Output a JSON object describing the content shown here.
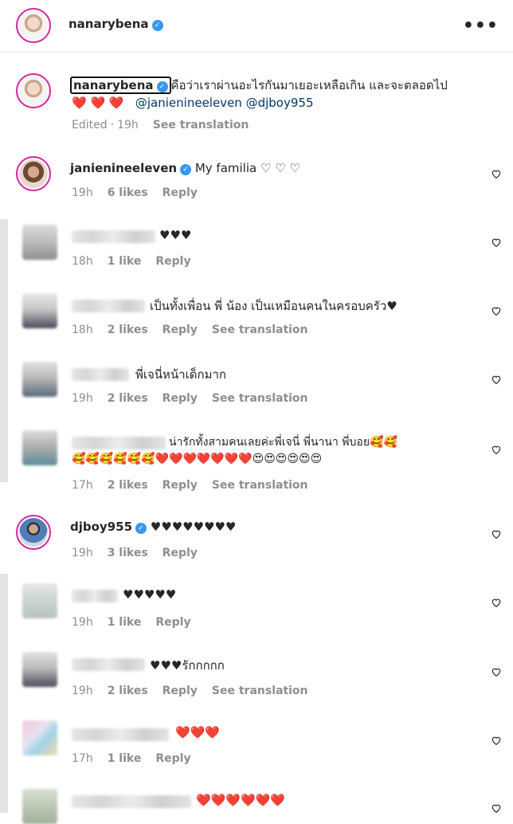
{
  "header": {
    "username": "nanarybena",
    "more_label": "•••"
  },
  "post": {
    "username": "nanarybena",
    "caption_line1": "คือว่าเราผ่านอะไรกันมาเยอะเหลือเกิน และจะตลอดไป",
    "hearts": "❤️ ❤️ ❤️",
    "mention1": "@janienineeleven",
    "mention2": "@djboy955",
    "edited": "Edited",
    "time": "19h",
    "see_translation": "See translation"
  },
  "comments": [
    {
      "username": "janienineeleven",
      "verified": true,
      "text": "My familia ♡ ♡ ♡",
      "time": "19h",
      "likes": "6 likes",
      "reply": "Reply",
      "see_translation": ""
    },
    {
      "username": "",
      "verified": false,
      "text": "♥♥♥",
      "time": "18h",
      "likes": "1 like",
      "reply": "Reply",
      "see_translation": ""
    },
    {
      "username": "",
      "verified": false,
      "text": "เป็นทั้งเพื่อน พี่ น้อง เป็นเหมือนคนในครอบครัว♥",
      "time": "18h",
      "likes": "2 likes",
      "reply": "Reply",
      "see_translation": "See translation"
    },
    {
      "username": "",
      "verified": false,
      "text": "พี่เจนี่หน้าเด็กมาก",
      "time": "19h",
      "likes": "2 likes",
      "reply": "Reply",
      "see_translation": "See translation"
    },
    {
      "username": "",
      "verified": false,
      "text": "น่ารักทั้งสามคนเลยค่ะพี่เจนี่ พี่นานา พี่บอย🥰🥰",
      "text2": "🥰🥰🥰🥰🥰🥰❤️❤️❤️❤️❤️❤️❤️😍😍😍😍😍😍",
      "time": "17h",
      "likes": "2 likes",
      "reply": "Reply",
      "see_translation": "See translation"
    },
    {
      "username": "djboy955",
      "verified": true,
      "text": "♥♥♥♥♥♥♥♥",
      "time": "19h",
      "likes": "3 likes",
      "reply": "Reply",
      "see_translation": ""
    },
    {
      "username": "",
      "verified": false,
      "text": "♥♥♥♥♥",
      "time": "19h",
      "likes": "1 like",
      "reply": "Reply",
      "see_translation": ""
    },
    {
      "username": "",
      "verified": false,
      "text": "♥♥♥รักกกกก",
      "time": "19h",
      "likes": "2 likes",
      "reply": "Reply",
      "see_translation": "See translation"
    },
    {
      "username": "",
      "verified": false,
      "text": "❤️❤️❤️",
      "time": "17h",
      "likes": "1 like",
      "reply": "Reply",
      "see_translation": ""
    },
    {
      "username": "",
      "verified": false,
      "text": "❤️❤️❤️❤️❤️❤️",
      "time": "",
      "likes": "",
      "reply": "",
      "see_translation": ""
    }
  ],
  "icons": {
    "like": "heart-outline-icon",
    "verified": "verified-badge-icon",
    "more": "more-options-icon"
  },
  "colors": {
    "verified": "#3897f0",
    "text": "#262626",
    "meta": "#8e8e8e",
    "mention": "#00376b",
    "story_ring": "#d6249f"
  }
}
